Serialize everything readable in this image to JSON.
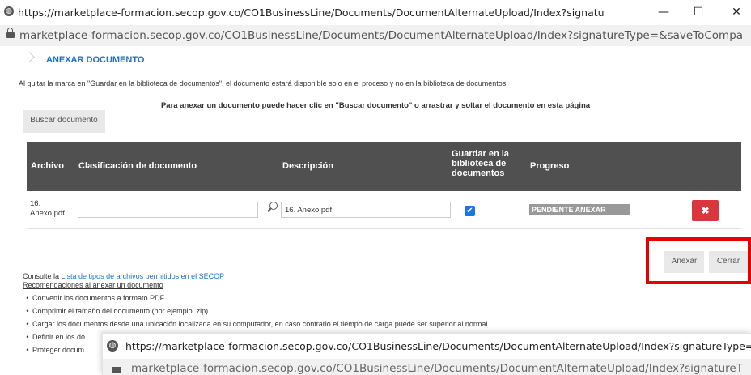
{
  "window": {
    "title": "https://marketplace-formacion.secop.gov.co/CO1BusinessLine/Documents/DocumentAlternateUpload/Index?signatureType=&saveToCompanyDocs=...",
    "minimize": "—",
    "maximize": "☐",
    "close": "✕"
  },
  "address_bar": {
    "url": "marketplace-formacion.secop.gov.co/CO1BusinessLine/Documents/DocumentAlternateUpload/Index?signatureType=&saveToCompanyDocs=Tru..."
  },
  "page": {
    "heading": "ANEXAR DOCUMENTO",
    "info_text": "Al quitar la marca en \"Guardar en la biblioteca de documentos\", el documento estará disponible solo en el proceso y no en la biblioteca de documentos.",
    "instruction": "Para anexar un documento puede hacer clic en \"Buscar documento\" o arrastrar y soltar el documento en esta página",
    "search_button": "Buscar documento"
  },
  "table": {
    "headers": {
      "archivo": "Archivo",
      "clasificacion": "Clasificación de documento",
      "descripcion": "Descripción",
      "guardar_l1": "Guardar en la",
      "guardar_l2": "biblioteca de",
      "guardar_l3": "documentos",
      "progreso": "Progreso"
    },
    "rows": [
      {
        "archivo_l1": "16.",
        "archivo_l2": "Anexo.pdf",
        "clasificacion": "",
        "descripcion": "16. Anexo.pdf",
        "guardar": true,
        "progreso": "PENDIENTE ANEXAR",
        "delete": "✖"
      }
    ]
  },
  "actions": {
    "anexar": "Anexar",
    "cerrar": "Cerrar"
  },
  "footer": {
    "consult_prefix": "Consulte la ",
    "consult_link": "Lista de tipos de archivos permitidos en el SECOP",
    "recs_title": "Recomendaciones al anexar un documento",
    "recs": [
      "Convertir los documentos a formato PDF.",
      "Comprimir el tamaño del documento (por ejemplo .zip).",
      "Cargar los documentos desde una ubicación localizada en su computador, en caso contrario el tiempo de carga puede ser superior al normal.",
      "Definir en los do",
      "Proteger docum"
    ]
  },
  "popup_window": {
    "title": "https://marketplace-formacion.secop.gov.co/CO1BusinessLine/Documents/DocumentAlternateUpload/Index?signatureType=&saveTo",
    "url": "marketplace-formacion.secop.gov.co/CO1BusinessLine/Documents/DocumentAlternateUpload/Index?signatureT"
  },
  "colors": {
    "accent": "#1a73c6",
    "header_bg": "#505050",
    "delete": "#d9363e",
    "highlight": "#e60000"
  }
}
